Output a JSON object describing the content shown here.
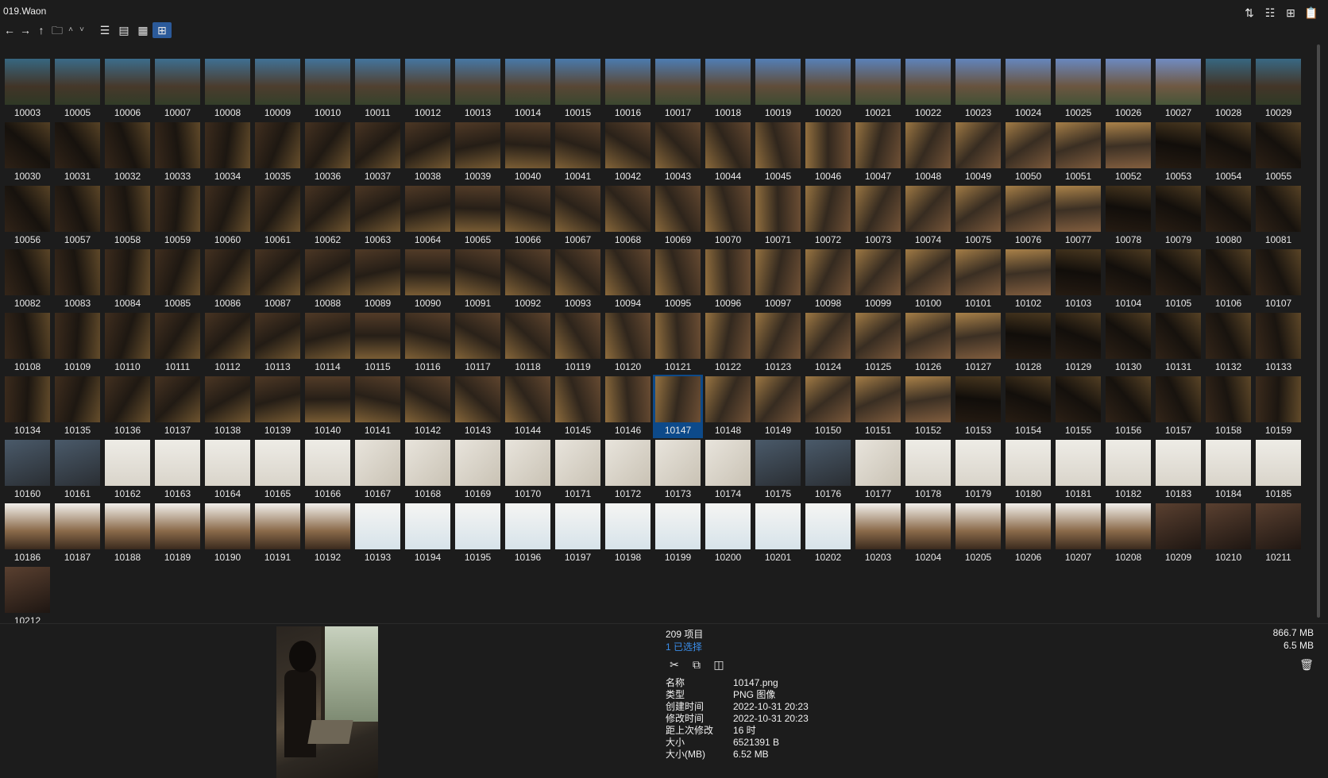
{
  "folder_title": "019.Waon",
  "toolbar": {
    "back_icon": "←",
    "forward_icon": "→",
    "up_icon": "↑",
    "folder_icon": "🗀",
    "chevron_up_icon": "˄",
    "chevron_down_icon": "˅",
    "view_list_icon": "☰",
    "view_details_icon": "▤",
    "view_tiles_icon": "▦",
    "view_thumbs_icon": "⊞",
    "active_view": "thumbnails"
  },
  "top_right_icons": {
    "sort_icon": "⇅",
    "columns_icon": "☷",
    "new_tab_icon": "⊞",
    "clipboard_icon": "📋"
  },
  "thumbnails": [
    "10003",
    "10005",
    "10006",
    "10007",
    "10008",
    "10009",
    "10010",
    "10011",
    "10012",
    "10013",
    "10014",
    "10015",
    "10016",
    "10017",
    "10018",
    "10019",
    "10020",
    "10021",
    "10022",
    "10023",
    "10024",
    "10025",
    "10026",
    "10027",
    "10028",
    "10029",
    "10030",
    "10031",
    "10032",
    "10033",
    "10034",
    "10035",
    "10036",
    "10037",
    "10038",
    "10039",
    "10040",
    "10041",
    "10042",
    "10043",
    "10044",
    "10045",
    "10046",
    "10047",
    "10048",
    "10049",
    "10050",
    "10051",
    "10052",
    "10053",
    "10054",
    "10055",
    "10056",
    "10057",
    "10058",
    "10059",
    "10060",
    "10061",
    "10062",
    "10063",
    "10064",
    "10065",
    "10066",
    "10067",
    "10068",
    "10069",
    "10070",
    "10071",
    "10072",
    "10073",
    "10074",
    "10075",
    "10076",
    "10077",
    "10078",
    "10079",
    "10080",
    "10081",
    "10082",
    "10083",
    "10084",
    "10085",
    "10086",
    "10087",
    "10088",
    "10089",
    "10090",
    "10091",
    "10092",
    "10093",
    "10094",
    "10095",
    "10096",
    "10097",
    "10098",
    "10099",
    "10100",
    "10101",
    "10102",
    "10103",
    "10104",
    "10105",
    "10106",
    "10107",
    "10108",
    "10109",
    "10110",
    "10111",
    "10112",
    "10113",
    "10114",
    "10115",
    "10116",
    "10117",
    "10118",
    "10119",
    "10120",
    "10121",
    "10122",
    "10123",
    "10124",
    "10125",
    "10126",
    "10127",
    "10128",
    "10129",
    "10130",
    "10131",
    "10132",
    "10133",
    "10134",
    "10135",
    "10136",
    "10137",
    "10138",
    "10139",
    "10140",
    "10141",
    "10142",
    "10143",
    "10144",
    "10145",
    "10146",
    "10147",
    "10148",
    "10149",
    "10150",
    "10151",
    "10152",
    "10153",
    "10154",
    "10155",
    "10156",
    "10157",
    "10158",
    "10159",
    "10160",
    "10161",
    "10162",
    "10163",
    "10164",
    "10165",
    "10166",
    "10167",
    "10168",
    "10169",
    "10170",
    "10171",
    "10172",
    "10173",
    "10174",
    "10175",
    "10176",
    "10177",
    "10178",
    "10179",
    "10180",
    "10181",
    "10182",
    "10183",
    "10184",
    "10185",
    "10186",
    "10187",
    "10188",
    "10189",
    "10190",
    "10191",
    "10192",
    "10193",
    "10194",
    "10195",
    "10196",
    "10197",
    "10198",
    "10199",
    "10200",
    "10201",
    "10202",
    "10203",
    "10204",
    "10205",
    "10206",
    "10207",
    "10208",
    "10209",
    "10210",
    "10211",
    "10212"
  ],
  "selected_thumbnail": "10147",
  "status": {
    "item_count": "209 项目",
    "selected_count": "1 已选择",
    "total_size": "866.7 MB",
    "selected_size": "6.5 MB"
  },
  "actions": {
    "cut_icon": "✂",
    "copy_icon": "⧉",
    "split_icon": "◫",
    "delete_icon": "🗑"
  },
  "properties": {
    "name_label": "名称",
    "name_value": "10147.png",
    "type_label": "类型",
    "type_value": "PNG 图像",
    "created_label": "创建时间",
    "created_value": "2022-10-31  20:23",
    "modified_label": "修改时间",
    "modified_value": "2022-10-31  20:23",
    "since_label": "距上次修改",
    "since_value": "16 时",
    "size_label": "大小",
    "size_value": "6521391 B",
    "size_mb_label": "大小(MB)",
    "size_mb_value": "6.52 MB"
  },
  "colors": {
    "background": "#1c1c1c",
    "selection": "#0d4a8a",
    "accent_text": "#3b8eea"
  }
}
